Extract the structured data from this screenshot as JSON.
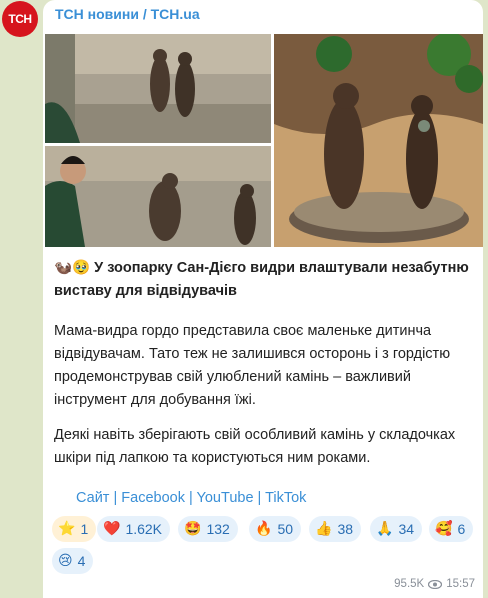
{
  "avatar": {
    "text": "ТСН"
  },
  "channel": {
    "title": "ТСН новини / ТСН.ua"
  },
  "post": {
    "headline_emoji": "🦦🥹",
    "headline": "У зоопарку Сан-Дієго видри влаштували незабутню виставу для відвідувачів",
    "para1_l1": "Мама-видра гордо представила своє маленьке дитинча",
    "para1_l2": "відвідувачам. Тато теж не залишився осторонь і з гордістю",
    "para1_l3": "продемонстрував свій улюблений камінь – важливий",
    "para1_l4": "інструмент для добування їжі.",
    "para2_l1": "Деякі навіть зберігають свій особливий камінь у складочках",
    "para2_l2": "шкіри під лапкою та користуються ним роками.",
    "links": [
      "Сайт",
      "Facebook",
      "YouTube",
      "TikTok"
    ],
    "separator": " | "
  },
  "reactions": [
    {
      "emoji": "⭐",
      "count": "1"
    },
    {
      "emoji": "❤️",
      "count": "1.62K"
    },
    {
      "emoji": "🤩",
      "count": "132"
    },
    {
      "emoji": "🔥",
      "count": "50"
    },
    {
      "emoji": "👍",
      "count": "38"
    },
    {
      "emoji": "🙏",
      "count": "34"
    },
    {
      "emoji": "🥰",
      "count": "6"
    },
    {
      "emoji": "😢",
      "count": "4"
    }
  ],
  "meta": {
    "views": "95.5K",
    "time": "15:57"
  }
}
